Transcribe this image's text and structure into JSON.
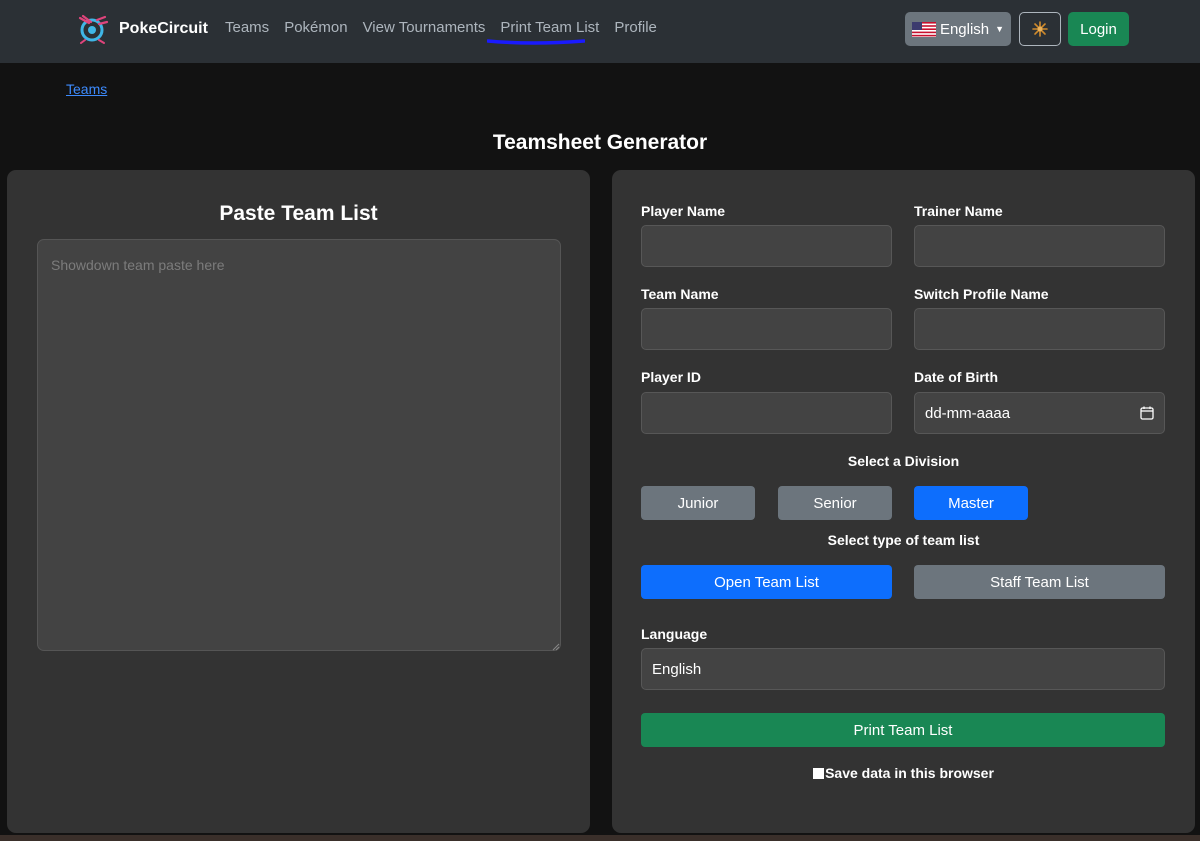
{
  "navbar": {
    "brand": "PokeCircuit",
    "links": [
      "Teams",
      "Pokémon",
      "View Tournaments",
      "Print Team List",
      "Profile"
    ],
    "language_button": "English",
    "login": "Login"
  },
  "breadcrumb": "Teams",
  "page_title": "Teamsheet Generator",
  "left_panel": {
    "heading": "Paste Team List",
    "textarea_placeholder": "Showdown team paste here"
  },
  "form": {
    "player_name_label": "Player Name",
    "trainer_name_label": "Trainer Name",
    "team_name_label": "Team Name",
    "switch_profile_label": "Switch Profile Name",
    "player_id_label": "Player ID",
    "dob_label": "Date of Birth",
    "dob_placeholder": "dd-mm-aaaa",
    "division_label": "Select a Division",
    "divisions": [
      "Junior",
      "Senior",
      "Master"
    ],
    "selected_division": "Master",
    "list_type_label": "Select type of team list",
    "list_types": [
      "Open Team List",
      "Staff Team List"
    ],
    "selected_list_type": "Open Team List",
    "language_label": "Language",
    "language_value": "English",
    "print_button": "Print Team List",
    "save_label": "Save data in this browser",
    "save_checked": false
  },
  "colors": {
    "primary": "#0d6efd",
    "secondary": "#6c757d",
    "success": "#198754",
    "navbar": "#2b3035",
    "panel": "#333333"
  }
}
